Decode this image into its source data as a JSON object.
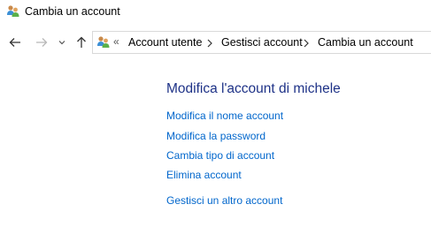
{
  "window": {
    "title": "Cambia un account",
    "icon": "user-accounts-icon"
  },
  "nav": {
    "back_icon": "arrow-left-icon",
    "forward_icon": "arrow-right-icon",
    "recent_icon": "chevron-down-icon",
    "up_icon": "arrow-up-icon",
    "overflow": "«",
    "breadcrumbs": [
      "Account utente",
      "Gestisci account",
      "Cambia un account"
    ]
  },
  "main": {
    "heading": "Modifica l'account di michele",
    "links": [
      "Modifica il nome account",
      "Modifica la password",
      "Cambia tipo di account",
      "Elimina account"
    ],
    "secondary_link": "Gestisci un altro account"
  },
  "colors": {
    "heading": "#1e3287",
    "link": "#0066cc"
  }
}
